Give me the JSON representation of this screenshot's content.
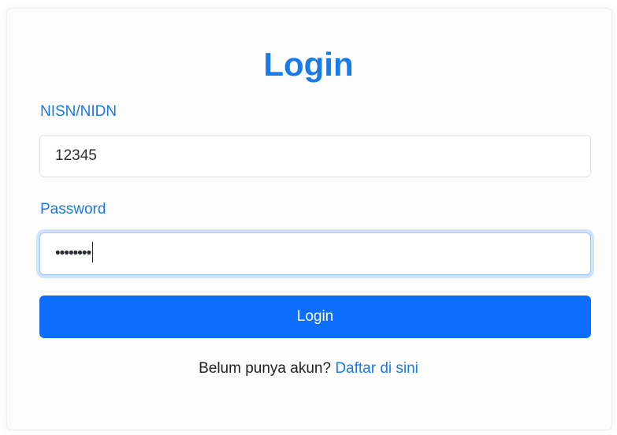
{
  "login_form": {
    "title": "Login",
    "nisn_label": "NISN/NIDN",
    "nisn_value": "12345",
    "password_label": "Password",
    "password_value": "••••••••",
    "submit_label": "Login",
    "register_prompt": "Belum punya akun?",
    "register_link": "Daftar di sini"
  },
  "colors": {
    "accent": "#1a7ae6",
    "button": "#0d6efd",
    "focus_border": "#9ec5fe"
  }
}
